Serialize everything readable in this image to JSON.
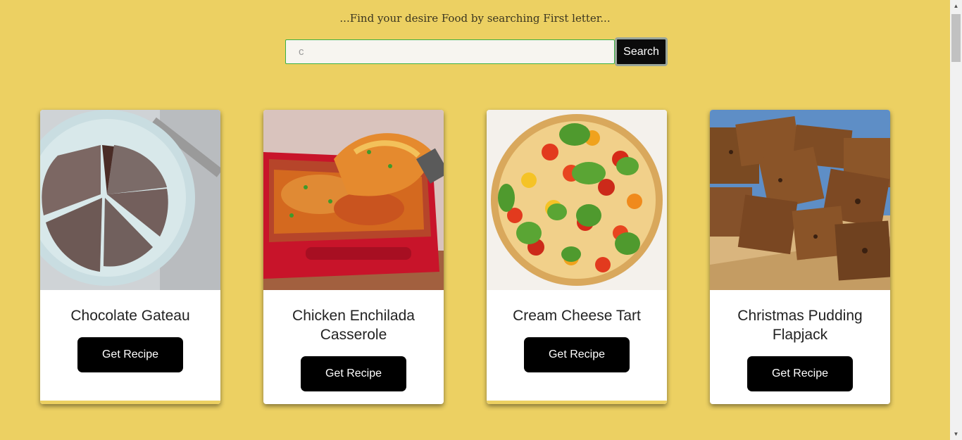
{
  "header": {
    "tagline": "...Find your desire Food by searching First letter..."
  },
  "search": {
    "value": "",
    "placeholder": "c",
    "button_label": "Search"
  },
  "cards": [
    {
      "title": "Chocolate Gateau",
      "button_label": "Get Recipe"
    },
    {
      "title": "Chicken Enchilada Casserole",
      "button_label": "Get Recipe"
    },
    {
      "title": "Cream Cheese Tart",
      "button_label": "Get Recipe"
    },
    {
      "title": "Christmas Pudding Flapjack",
      "button_label": "Get Recipe"
    }
  ],
  "colors": {
    "background": "#ecd062",
    "card": "#ffffff",
    "button": "#000000",
    "input_border": "#3cb043"
  }
}
